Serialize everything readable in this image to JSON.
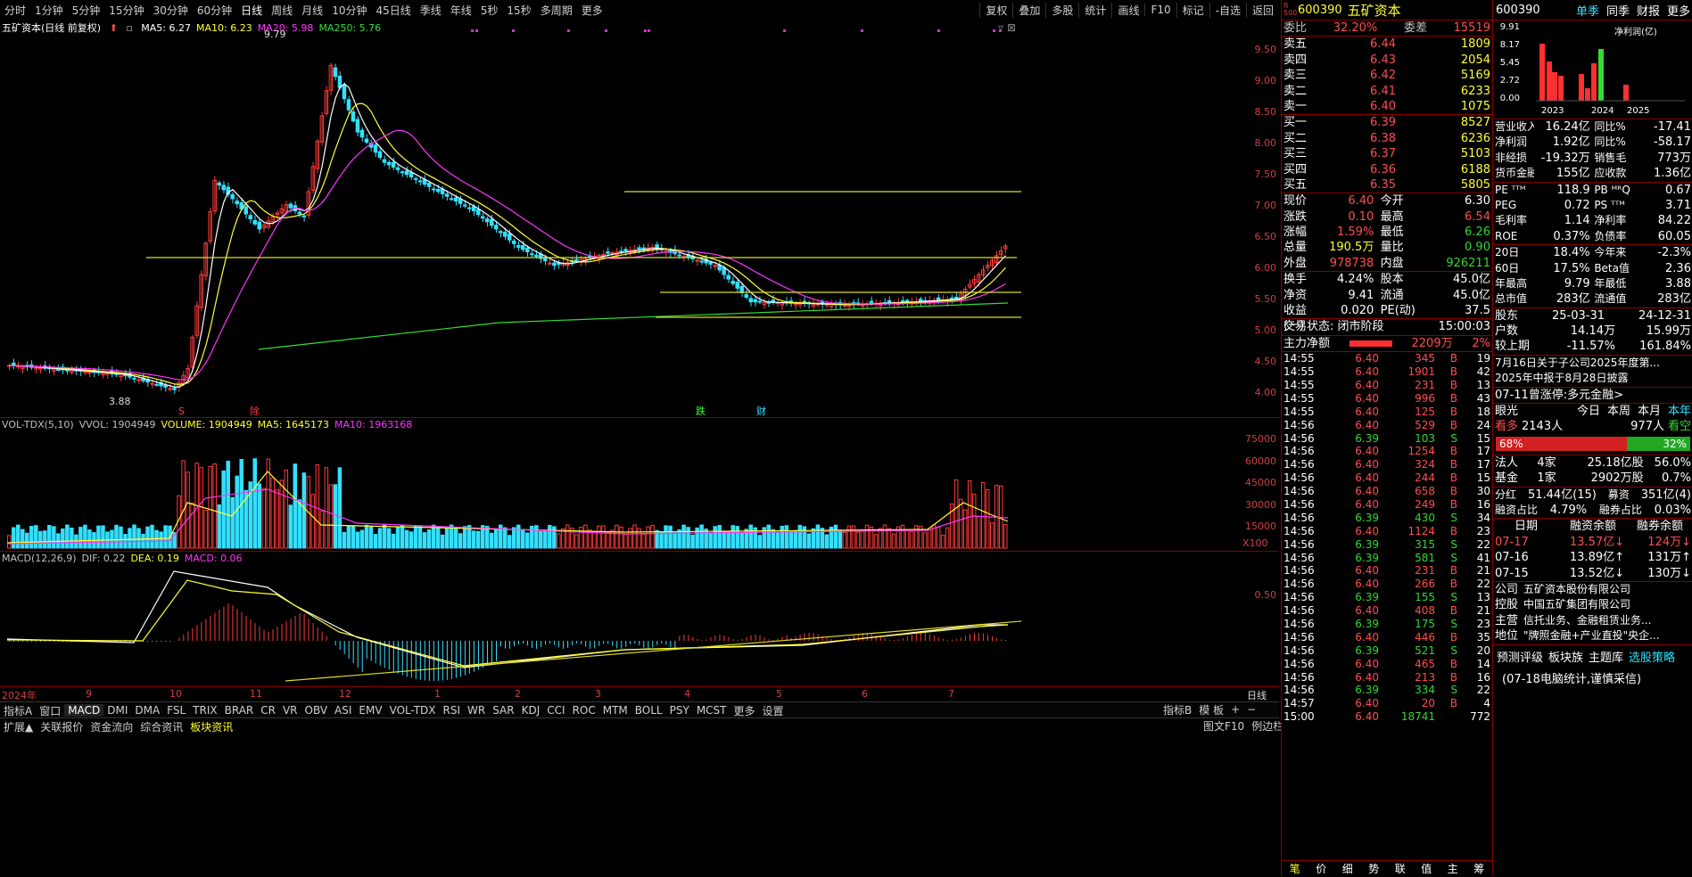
{
  "toolbar": {
    "periods": [
      "分时",
      "1分钟",
      "5分钟",
      "15分钟",
      "30分钟",
      "60分钟",
      "日线",
      "周线",
      "月线",
      "10分钟",
      "45日线",
      "季线",
      "年线",
      "5秒",
      "15秒",
      "多周期",
      "更多"
    ],
    "active_period": "日线",
    "right_tools": [
      "复权",
      "叠加",
      "多股",
      "统计",
      "画线",
      "F10",
      "标记",
      "-自选",
      "返回"
    ]
  },
  "kline": {
    "title": "五矿资本(日线 前复权)",
    "ma": [
      {
        "label": "MA5: 6.27",
        "color": "#ffffff"
      },
      {
        "label": "MA10: 6.23",
        "color": "#ffff33"
      },
      {
        "label": "MA20: 5.98",
        "color": "#ff33ff"
      },
      {
        "label": "MA250: 5.76",
        "color": "#33dd33"
      }
    ],
    "high_label": "9.79",
    "low_label": "3.88",
    "y_ticks": [
      "9.50",
      "9.00",
      "8.50",
      "8.00",
      "7.50",
      "7.00",
      "6.50",
      "6.00",
      "5.50",
      "5.00",
      "4.50",
      "4.00"
    ],
    "markers": [
      "S",
      "除",
      "跌",
      "财"
    ]
  },
  "volume": {
    "legend": [
      {
        "label": "VOL-TDX(5,10)",
        "color": "#c0c0c0"
      },
      {
        "label": "VVOL: 1904949",
        "color": "#c0c0c0"
      },
      {
        "label": "VOLUME: 1904949",
        "color": "#ffff33"
      },
      {
        "label": "MA5: 1645173",
        "color": "#ffff33"
      },
      {
        "label": "MA10: 1963168",
        "color": "#ff33ff"
      }
    ],
    "y_ticks": [
      "75000",
      "60000",
      "45000",
      "30000",
      "15000"
    ],
    "unit": "X100"
  },
  "macd": {
    "legend": [
      {
        "label": "MACD(12,26,9)",
        "color": "#c0c0c0"
      },
      {
        "label": "DIF: 0.22",
        "color": "#c0c0c0"
      },
      {
        "label": "DEA: 0.19",
        "color": "#ffff33"
      },
      {
        "label": "MACD: 0.06",
        "color": "#ff33ff"
      }
    ],
    "y_ticks": [
      "0.50"
    ]
  },
  "date_axis": {
    "labels": [
      "2024年",
      "9",
      "10",
      "11",
      "12",
      "1",
      "2",
      "3",
      "4",
      "5",
      "6",
      "7"
    ],
    "right": "日线"
  },
  "indicator_tabs": [
    "指标A",
    "窗口",
    "MACD",
    "DMI",
    "DMA",
    "FSL",
    "TRIX",
    "BRAR",
    "CR",
    "VR",
    "OBV",
    "ASI",
    "EMV",
    "VOL-TDX",
    "RSI",
    "WR",
    "SAR",
    "KDJ",
    "CCI",
    "ROC",
    "MTM",
    "BOLL",
    "PSY",
    "MCST",
    "更多",
    "设置"
  ],
  "indicator_selected": "MACD",
  "indicator_right": [
    "指标B",
    "模 板",
    "+",
    "−"
  ],
  "bottom_tabs": [
    "扩展▲",
    "关联报价",
    "资金流向",
    "综合资讯",
    "板块资讯"
  ],
  "bottom_right": [
    "图文F10",
    "例边栏»"
  ],
  "quote": {
    "code": "600390",
    "name": "五矿资本",
    "badge": "R 500",
    "weibi_label": "委比",
    "weibi": "32.20%",
    "weicha_label": "委差",
    "weicha": "15519",
    "asks": [
      {
        "label": "卖五",
        "price": "6.44",
        "vol": "1809"
      },
      {
        "label": "卖四",
        "price": "6.43",
        "vol": "2054"
      },
      {
        "label": "卖三",
        "price": "6.42",
        "vol": "5169"
      },
      {
        "label": "卖二",
        "price": "6.41",
        "vol": "6233"
      },
      {
        "label": "卖一",
        "price": "6.40",
        "vol": "1075"
      }
    ],
    "bids": [
      {
        "label": "买一",
        "price": "6.39",
        "vol": "8527"
      },
      {
        "label": "买二",
        "price": "6.38",
        "vol": "6236"
      },
      {
        "label": "买三",
        "price": "6.37",
        "vol": "5103"
      },
      {
        "label": "买四",
        "price": "6.36",
        "vol": "6188"
      },
      {
        "label": "买五",
        "price": "6.35",
        "vol": "5805"
      }
    ],
    "stats": [
      {
        "l1": "现价",
        "v1": "6.40",
        "c1": "red",
        "l2": "今开",
        "v2": "6.30",
        "c2": "white"
      },
      {
        "l1": "涨跌",
        "v1": "0.10",
        "c1": "red",
        "l2": "最高",
        "v2": "6.54",
        "c2": "red"
      },
      {
        "l1": "涨幅",
        "v1": "1.59%",
        "c1": "red",
        "l2": "最低",
        "v2": "6.26",
        "c2": "green"
      },
      {
        "l1": "总量",
        "v1": "190.5万",
        "c1": "yellow",
        "l2": "量比",
        "v2": "0.90",
        "c2": "green"
      },
      {
        "l1": "外盘",
        "v1": "978738",
        "c1": "red",
        "l2": "内盘",
        "v2": "926211",
        "c2": "green"
      }
    ],
    "stats2": [
      {
        "l1": "换手",
        "v1": "4.24%",
        "l2": "股本",
        "v2": "45.0亿"
      },
      {
        "l1": "净资",
        "v1": "9.41",
        "l2": "流通",
        "v2": "45.0亿"
      },
      {
        "l1": "收益(一)",
        "v1": "0.020",
        "l2": "PE(动)",
        "v2": "37.5"
      }
    ],
    "status_label": "交易状态: 闭市阶段",
    "status_time": "15:00:03",
    "mainflow_label": "主力净额",
    "mainflow_value": "2209万",
    "mainflow_pct": "2%",
    "ticks": [
      [
        "14:55",
        "6.40",
        "345",
        "B",
        "19"
      ],
      [
        "14:55",
        "6.40",
        "1901",
        "B",
        "42"
      ],
      [
        "14:55",
        "6.40",
        "231",
        "B",
        "13"
      ],
      [
        "14:55",
        "6.40",
        "996",
        "B",
        "43"
      ],
      [
        "14:55",
        "6.40",
        "125",
        "B",
        "18"
      ],
      [
        "14:56",
        "6.40",
        "529",
        "B",
        "24"
      ],
      [
        "14:56",
        "6.39",
        "103",
        "S",
        "15"
      ],
      [
        "14:56",
        "6.40",
        "1254",
        "B",
        "17"
      ],
      [
        "14:56",
        "6.40",
        "324",
        "B",
        "17"
      ],
      [
        "14:56",
        "6.40",
        "244",
        "B",
        "15"
      ],
      [
        "14:56",
        "6.40",
        "658",
        "B",
        "30"
      ],
      [
        "14:56",
        "6.40",
        "249",
        "B",
        "16"
      ],
      [
        "14:56",
        "6.39",
        "430",
        "S",
        "34"
      ],
      [
        "14:56",
        "6.40",
        "1124",
        "B",
        "23"
      ],
      [
        "14:56",
        "6.39",
        "315",
        "S",
        "22"
      ],
      [
        "14:56",
        "6.39",
        "581",
        "S",
        "41"
      ],
      [
        "14:56",
        "6.40",
        "231",
        "B",
        "21"
      ],
      [
        "14:56",
        "6.40",
        "266",
        "B",
        "22"
      ],
      [
        "14:56",
        "6.39",
        "155",
        "S",
        "13"
      ],
      [
        "14:56",
        "6.40",
        "408",
        "B",
        "21"
      ],
      [
        "14:56",
        "6.39",
        "175",
        "S",
        "23"
      ],
      [
        "14:56",
        "6.40",
        "446",
        "B",
        "35"
      ],
      [
        "14:56",
        "6.39",
        "521",
        "S",
        "20"
      ],
      [
        "14:56",
        "6.40",
        "465",
        "B",
        "14"
      ],
      [
        "14:56",
        "6.40",
        "213",
        "B",
        "16"
      ],
      [
        "14:56",
        "6.39",
        "334",
        "S",
        "22"
      ],
      [
        "14:57",
        "6.40",
        "20",
        "B",
        "4"
      ],
      [
        "15:00",
        "6.40",
        "18741",
        "",
        "772"
      ]
    ],
    "bottom_tabs": [
      "笔",
      "价",
      "细",
      "势",
      "联",
      "值",
      "主",
      "筹"
    ]
  },
  "f10": {
    "code": "600390",
    "tabs": [
      "单季",
      "同季",
      "财报",
      "更多"
    ],
    "bar_years": [
      "2023",
      "2024",
      "2025"
    ],
    "bar_label": "净利润(亿)",
    "bar_y": [
      "9.91",
      "8.17",
      "5.45",
      "2.72",
      "0.00"
    ],
    "rows1": [
      {
        "l1": "营业收入",
        "v1": "16.24亿",
        "l2": "同比%",
        "v2": "-17.41"
      },
      {
        "l1": "净利润",
        "v1": "1.92亿",
        "l2": "同比%",
        "v2": "-58.17"
      },
      {
        "l1": "非经损",
        "v1": "-19.32万",
        "l2": "销售毛",
        "v2": "773万"
      },
      {
        "l1": "货币金融",
        "v1": "155亿",
        "l2": "应收款",
        "v2": "1.36亿"
      }
    ],
    "rows2": [
      {
        "l1": "PE ᵀᵀᴹ",
        "v1": "118.9",
        "l2": "PB ᴹᴿQ",
        "v2": "0.67"
      },
      {
        "l1": "PEG",
        "v1": "0.72",
        "l2": "PS ᵀᵀᴹ",
        "v2": "3.71"
      },
      {
        "l1": "毛利率",
        "v1": "1.14",
        "l2": "净利率",
        "v2": "84.22"
      },
      {
        "l1": "ROE",
        "v1": "0.37%",
        "l2": "负债率",
        "v2": "60.05"
      }
    ],
    "rows3": [
      {
        "l1": "20日",
        "v1": "18.4%",
        "l2": "今年来",
        "v2": "-2.3%"
      },
      {
        "l1": "60日",
        "v1": "17.5%",
        "l2": "Beta值",
        "v2": "2.36"
      },
      {
        "l1": "年最高",
        "v1": "9.79",
        "l2": "年最低",
        "v2": "3.88"
      },
      {
        "l1": "总市值",
        "v1": "283亿",
        "l2": "流通值",
        "v2": "283亿"
      }
    ],
    "holders": {
      "label": "股东",
      "d1": "25-03-31",
      "d2": "24-12-31",
      "rows": [
        [
          "户数",
          "14.14万",
          "15.99万"
        ],
        [
          "较上期",
          "-11.57%",
          "161.84%"
        ]
      ]
    },
    "news": [
      "7月16日关于子公司2025年度第...",
      "2025年中报于8月28日披露"
    ],
    "news2": "07-11曾涨停:多元金融>",
    "vision": {
      "label": "眼光",
      "tabs": [
        "今日",
        "本周",
        "本月",
        "本年"
      ],
      "bull_label": "看多",
      "bull": "2143人",
      "bear": "977人",
      "bear_label": "看空",
      "bull_pct": "68%",
      "bear_pct": "32%"
    },
    "inst": [
      {
        "l": "法人",
        "n": "4家",
        "v": "25.18亿股",
        "p": "56.0%"
      },
      {
        "l": "基金",
        "n": "1家",
        "v": "2902万股",
        "p": "0.7%"
      }
    ],
    "div": {
      "l1": "分红",
      "v1": "51.44亿(15)",
      "l2": "募资",
      "v2": "351亿(4)"
    },
    "margin": {
      "l1": "融资占比",
      "v1": "4.79%",
      "l2": "融券占比",
      "v2": "0.03%"
    },
    "margin_table": {
      "head": [
        "日期",
        "融资余额",
        "融券余额"
      ],
      "rows": [
        [
          "07-17",
          "13.57亿↓",
          "124万↓"
        ],
        [
          "07-16",
          "13.89亿↑",
          "131万↑"
        ],
        [
          "07-15",
          "13.52亿↓",
          "130万↓"
        ]
      ]
    },
    "company": [
      {
        "l": "公司",
        "v": "五矿资本股份有限公司"
      },
      {
        "l": "控股",
        "v": "中国五矿集团有限公司"
      },
      {
        "l": "主营",
        "v": "信托业务、金融租赁业务..."
      },
      {
        "l": "地位",
        "v": "\"牌照金融+产业直投\"央企..."
      }
    ],
    "footer_links": [
      "预测评级",
      "板块族",
      "主题库",
      "选股策略"
    ],
    "footer_note": "(07-18电脑统计,谨慎采信)"
  }
}
